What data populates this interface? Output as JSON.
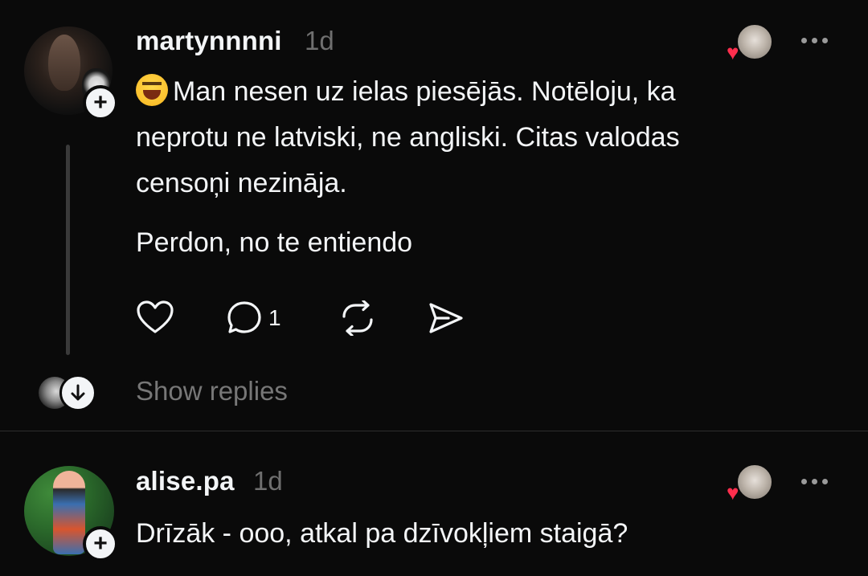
{
  "post1": {
    "username": "martynnnni",
    "time": "1d",
    "avatar_icon": "profile-photo",
    "follow_symbol": "+",
    "emoji": "laughing-emoji",
    "lines": [
      "Man nesen uz ielas piesējās. Notēloju, ka",
      "neprotu ne latviski, ne angliski. Citas valodas",
      "censoņi nezināja."
    ],
    "paragraph2": "Perdon, no te entiendo",
    "actions": {
      "like_icon": "heart-outline-icon",
      "comment_icon": "comment-icon",
      "comment_count": "1",
      "repost_icon": "repost-icon",
      "share_icon": "send-icon"
    },
    "liked_by_icon": "heart-icon",
    "show_replies": "Show replies"
  },
  "post2": {
    "username": "alise.pa",
    "time": "1d",
    "avatar_icon": "profile-photo",
    "follow_symbol": "+",
    "text": "Drīzāk - ooo, atkal pa dzīvokļiem staigā?",
    "liked_by_icon": "heart-icon"
  },
  "colors": {
    "background": "#0a0a0a",
    "text": "#f3f5f7",
    "muted": "#777777",
    "heart": "#ff2e4d"
  }
}
